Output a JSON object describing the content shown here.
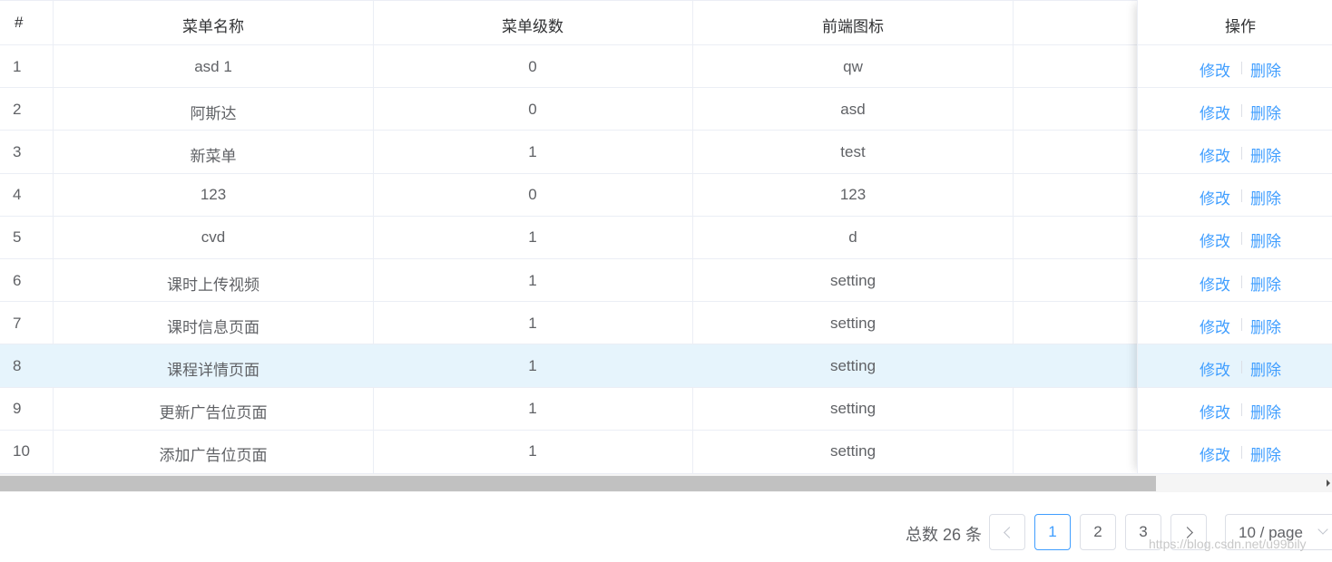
{
  "table": {
    "headers": {
      "index": "#",
      "name": "菜单名称",
      "level": "菜单级数",
      "icon": "前端图标",
      "extra": "",
      "actions": "操作"
    },
    "rows": [
      {
        "index": "1",
        "name": "asd 1",
        "level": "0",
        "icon": "qw"
      },
      {
        "index": "2",
        "name": "阿斯达",
        "level": "0",
        "icon": "asd"
      },
      {
        "index": "3",
        "name": "新菜单",
        "level": "1",
        "icon": "test"
      },
      {
        "index": "4",
        "name": "123",
        "level": "0",
        "icon": "123"
      },
      {
        "index": "5",
        "name": "cvd",
        "level": "1",
        "icon": "d"
      },
      {
        "index": "6",
        "name": "课时上传视频",
        "level": "1",
        "icon": "setting"
      },
      {
        "index": "7",
        "name": "课时信息页面",
        "level": "1",
        "icon": "setting"
      },
      {
        "index": "8",
        "name": "课程详情页面",
        "level": "1",
        "icon": "setting"
      },
      {
        "index": "9",
        "name": "更新广告位页面",
        "level": "1",
        "icon": "setting"
      },
      {
        "index": "10",
        "name": "添加广告位页面",
        "level": "1",
        "icon": "setting"
      }
    ],
    "highlighted_row": 8,
    "edit_label": "修改",
    "delete_label": "删除"
  },
  "pagination": {
    "total_text": "总数 26 条",
    "prev_icon": "chevron-left-icon",
    "next_icon": "chevron-right-icon",
    "pages": [
      "1",
      "2",
      "3"
    ],
    "current_page": "1",
    "page_size": "10 / page",
    "page_size_icon": "chevron-down-icon"
  },
  "watermark": "https://blog.csdn.net/u99bily",
  "colors": {
    "accent": "#409eff",
    "highlight_row": "#e6f4fc",
    "border": "#ebeef5",
    "text": "#606266"
  }
}
